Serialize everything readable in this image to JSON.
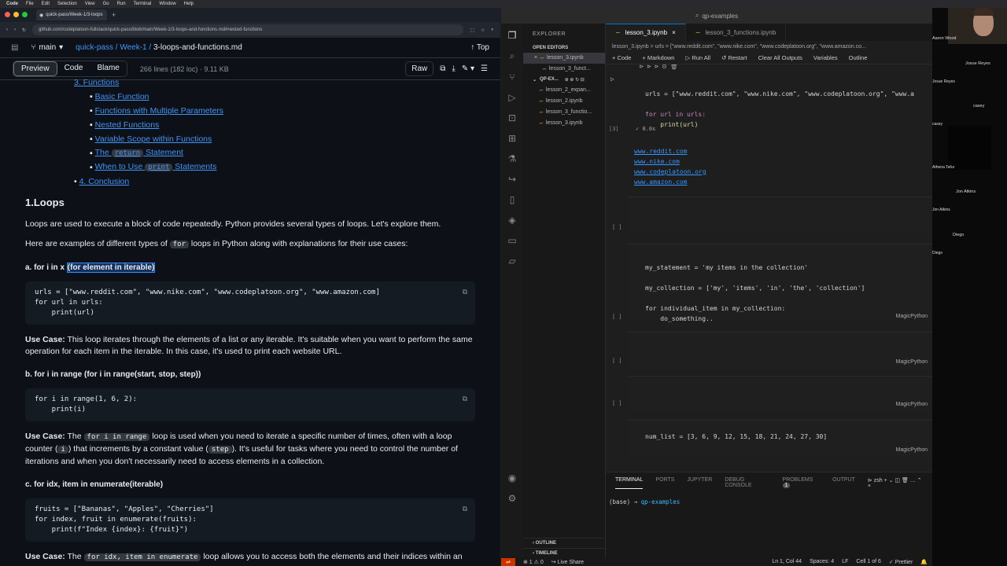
{
  "menubar": {
    "app": "Code",
    "items": [
      "File",
      "Edit",
      "Selection",
      "View",
      "Go",
      "Run",
      "Terminal",
      "Window",
      "Help"
    ]
  },
  "browser": {
    "tab_title": "quick-pass/Week-1/3-loops",
    "url": "github.com/codeplatoon-fullstack/quick-pass/blob/main/Week-1/3-loops-and-functions.md#nested-functions",
    "branch": "main",
    "repo": "quick-pass",
    "folder": "Week-1",
    "file": "3-loops-and-functions.md",
    "top_label": "Top",
    "tabs": {
      "preview": "Preview",
      "code": "Code",
      "blame": "Blame"
    },
    "meta": "266 lines (182 loc) · 9.11 KB",
    "raw": "Raw"
  },
  "md": {
    "toc_partial": "3. Functions",
    "toc": [
      "Basic Function",
      "Functions with Multiple Parameters",
      "Nested Functions",
      "Variable Scope within Functions"
    ],
    "toc_return_pre": "The",
    "toc_return_code": "return",
    "toc_return_post": "Statement",
    "toc_print_pre": "When to Use",
    "toc_print_code": "print",
    "toc_print_post": "Statements",
    "toc_conclusion": "4. Conclusion",
    "h_loops": "1.Loops",
    "intro1": "Loops are used to execute a block of code repeatedly. Python provides several types of loops. Let's explore them.",
    "intro2_pre": "Here are examples of different types of",
    "intro2_code": "for",
    "intro2_post": "loops in Python along with explanations for their use cases:",
    "h_a_pre": "a. for i in x ",
    "h_a_hl": "(for element in iterable)",
    "code_a": [
      "urls = [\"www.reddit.com\", \"www.nike.com\", \"www.codeplatoon.org\", \"www.amazon.com]",
      "for url in urls:",
      "    print(url)"
    ],
    "use_label": "Use Case:",
    "use_a": "This loop iterates through the elements of a list or any iterable. It's suitable when you want to perform the same operation for each item in the iterable. In this case, it's used to print each website URL.",
    "h_b": "b. for i in range (for i in range(start, stop, step))",
    "code_b": [
      "for i in range(1, 6, 2):",
      "    print(i)"
    ],
    "use_b_1": "The",
    "use_b_code1": "for i in range",
    "use_b_2": "loop is used when you need to iterate a specific number of times, often with a loop counter (",
    "use_b_code2": "i",
    "use_b_3": ") that increments by a constant value (",
    "use_b_code3": "step",
    "use_b_4": "). It's useful for tasks where you need to control the number of iterations and when you don't necessarily need to access elements in a collection.",
    "h_c": "c. for idx, item in enumerate(iterable)",
    "code_c": [
      "fruits = [\"Bananas\", \"Apples\", \"Cherries\"]",
      "for index, fruit in enumerate(fruits):",
      "    print(f\"Index {index}: {fruit}\")"
    ],
    "use_c_1": "The",
    "use_c_code": "for idx, item in enumerate",
    "use_c_2": "loop allows you to access both the elements and their indices within an"
  },
  "vscode": {
    "title": "qp-examples",
    "explorer": "EXPLORER",
    "open_editors": "OPEN EDITORS",
    "open_files": [
      "lesson_3.ipynb",
      "lesson_3_funct..."
    ],
    "workspace": "QP-EX...",
    "files": [
      "lesson_2_expan...",
      "lesson_2.ipynb",
      "lesson_3_functio...",
      "lesson_3.ipynb"
    ],
    "outline": "OUTLINE",
    "timeline": "TIMELINE",
    "tabs": [
      "lesson_3.ipynb",
      "lesson_3_functions.ipynb"
    ],
    "breadcrumb": "lesson_3.ipynb  >  urls = [\"www.reddit.com\", \"www.nike.com\", \"www.codeplatoon.org\", \"www.amazon.co...",
    "toolbar": [
      "+ Code",
      "+ Markdown",
      "▷ Run All",
      "↺ Restart",
      "Clear All Outputs",
      "Variables",
      "Outline"
    ],
    "cell1": [
      "urls = [\"www.reddit.com\", \"www.nike.com\", \"www.codeplatoon.org\", \"www.a",
      "",
      "for url in urls:",
      "    print(url)"
    ],
    "cell1_exec": "[3]",
    "cell1_time": "0.0s",
    "outputs": [
      "www.reddit.com",
      "www.nike.com",
      "www.codeplatoon.org",
      "www.amazon.com"
    ],
    "cell3": [
      "my_statement = 'my items in the collection'",
      "",
      "my_collection = ['my', 'items', 'in', 'the', 'collection']",
      "",
      "for individual_item in my_collection:",
      "    do_something.."
    ],
    "cell7": "num_list = [3, 6, 9, 12, 15, 18, 21, 24, 27, 30]",
    "empty_bracket": "[ ]",
    "magic": "MagicPython",
    "panel_tabs": [
      "TERMINAL",
      "PORTS",
      "JUPYTER",
      "DEBUG CONSOLE",
      "PROBLEMS",
      "OUTPUT"
    ],
    "problems_count": "1",
    "shell": "zsh",
    "terminal_prompt": "(base) → ",
    "terminal_dir": "qp-examples",
    "status": {
      "errors": "⊗ 1 ⚠ 0",
      "live": "Live Share",
      "pos": "Ln 1, Col 44",
      "spaces": "Spaces: 4",
      "eol": "LF",
      "cell": "Cell 1 of 6",
      "prettier": "✓ Prettier"
    }
  },
  "participants": [
    "Aaron Wood",
    "Josue Reyes",
    "Josue Reyes",
    "casey",
    "casey",
    "Athena Tafur",
    "Jon Atkins",
    "Jon Atkins",
    "Diego",
    "Diego"
  ]
}
